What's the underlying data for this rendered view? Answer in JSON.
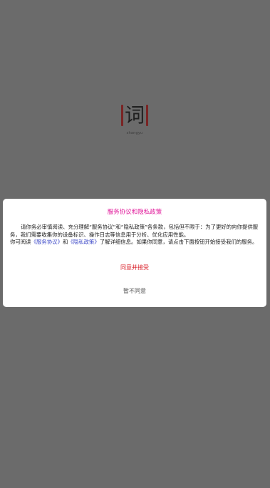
{
  "splash": {
    "logo_char": "词",
    "logo_caption": "shangyu"
  },
  "dialog": {
    "title": "服务协议和隐私政策",
    "paragraph1": "请你务必审慎阅读、充分理解“服务协议”和“隐私政策”各条款，包括但不限于：为了更好的向你提供服务，我们需要收集你的设备标识、操作日志等信息用于分析、优化应用性能。",
    "paragraph2_prefix": "你可阅读",
    "service_link": "《服务协议》",
    "and_text": "和",
    "privacy_link": "《隐私政策》",
    "paragraph2_suffix": "了解详细信息。如果你同意，请点击下面按钮开始接受我们的服务。",
    "agree_label": "同意并接受",
    "disagree_label": "暂不同意"
  },
  "colors": {
    "overlay": "#6b6b6b",
    "title": "#e0189a",
    "link": "#3d49c8",
    "agree": "#d9202a",
    "disagree": "#555555"
  }
}
